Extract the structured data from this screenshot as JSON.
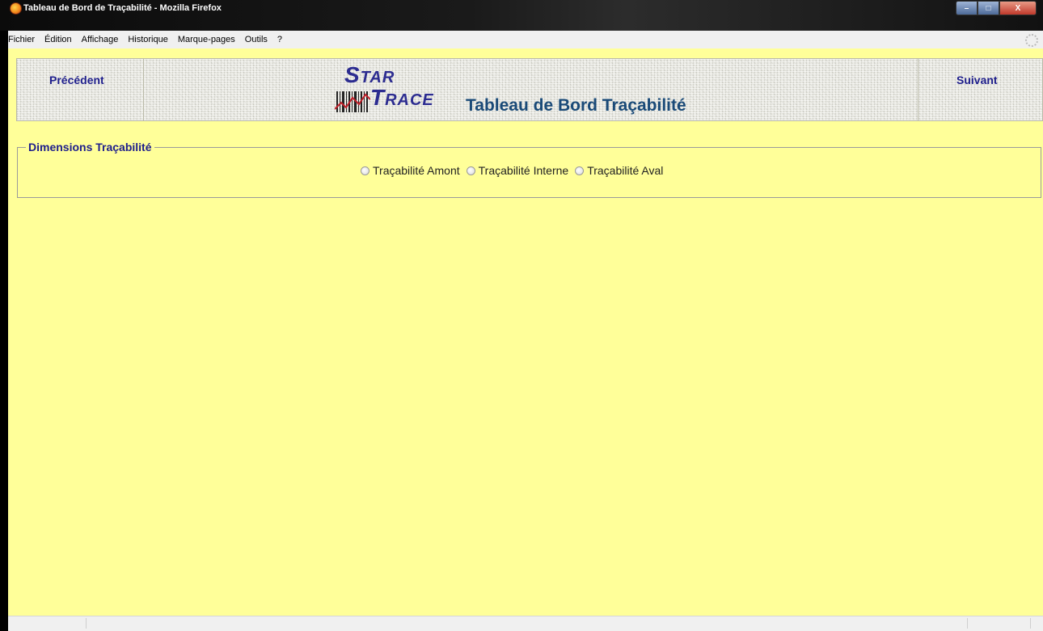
{
  "window": {
    "title": "Tableau de Bord de Traçabilité - Mozilla Firefox",
    "buttons": {
      "minimize": "–",
      "maximize": "□",
      "close": "X"
    }
  },
  "menu": {
    "items": [
      "Fichier",
      "Édition",
      "Affichage",
      "Historique",
      "Marque-pages",
      "Outils",
      "?"
    ]
  },
  "header": {
    "prev_label": "Précédent",
    "next_label": "Suivant",
    "logo_top": "Star",
    "logo_bottom": "Trace",
    "title": "Tableau de Bord Traçabilité"
  },
  "dimensions": {
    "legend": "Dimensions Traçabilité",
    "options": [
      "Traçabilité Amont",
      "Traçabilité Interne",
      "Traçabilité Aval"
    ]
  },
  "colors": {
    "page_background": "#ffff99",
    "link_color": "#1e1e8c",
    "title_color": "#1a4a78"
  },
  "icons": {
    "browser": "firefox-icon",
    "loading": "throbber-icon"
  }
}
